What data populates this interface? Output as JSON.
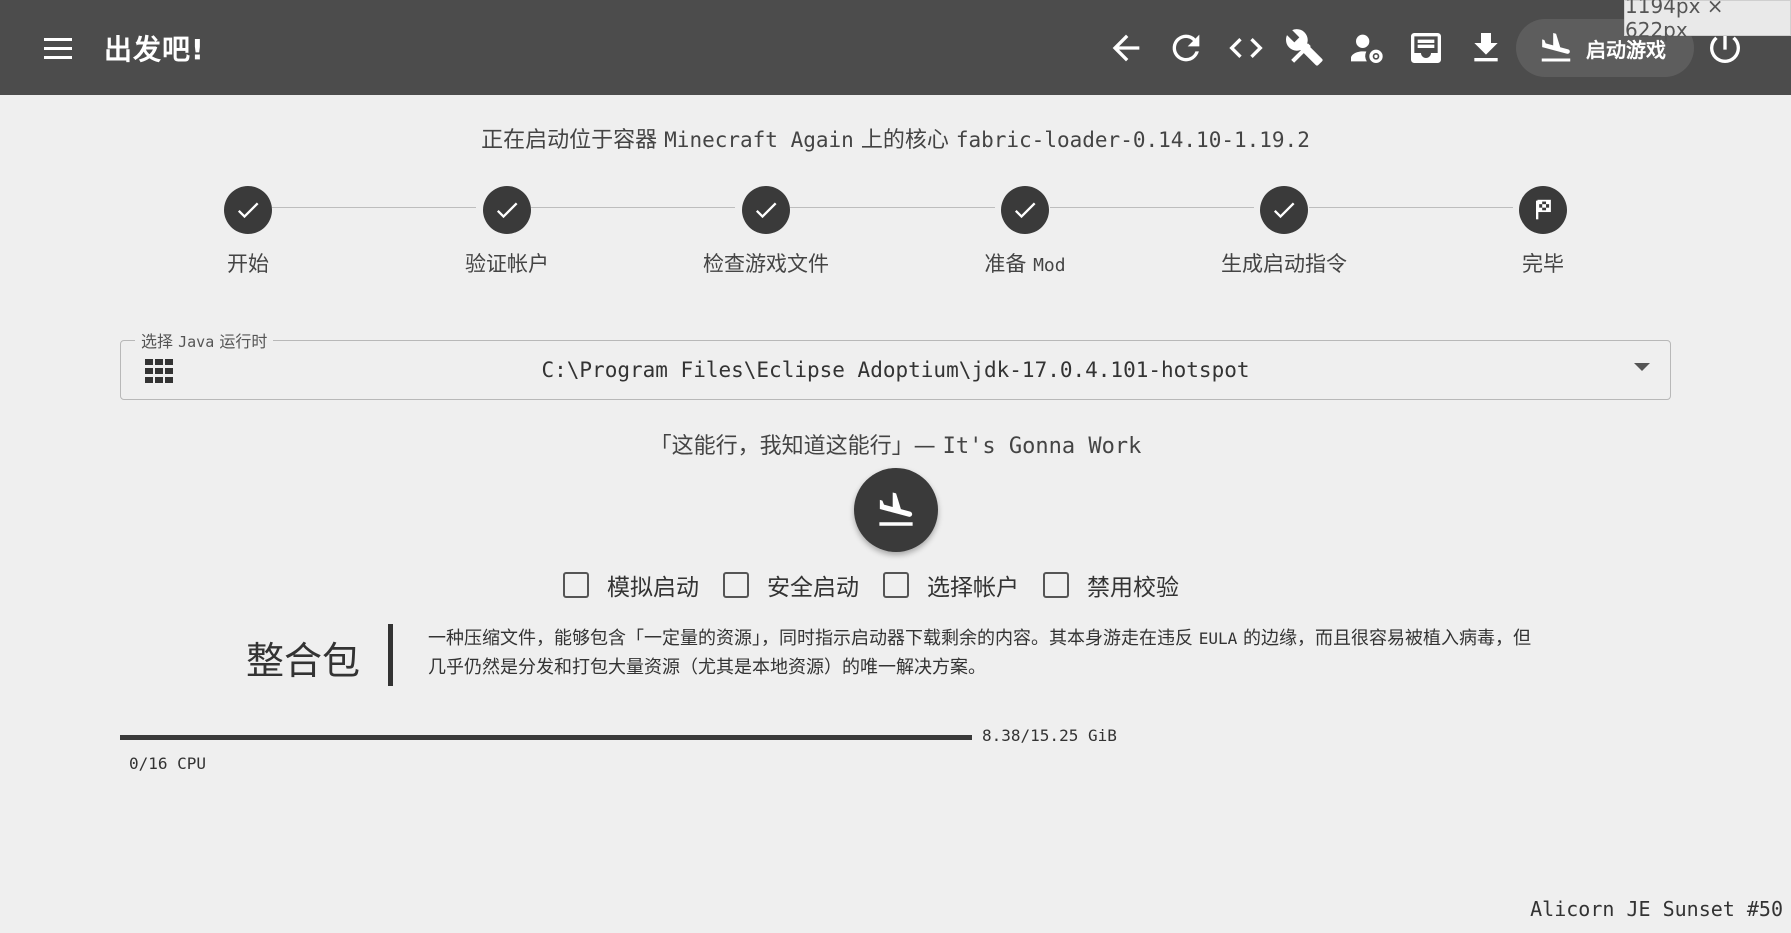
{
  "appbar": {
    "title": "出发吧!",
    "launch_label": "启动游戏",
    "size_badge": "1194px × 622px",
    "tools": [
      "back-icon",
      "reload-icon",
      "code-icon",
      "tools-icon",
      "account-settings-icon",
      "inbox-icon",
      "download-icon"
    ]
  },
  "launch": {
    "prefix": "正在启动位于容器",
    "container": "Minecraft Again",
    "middle": "上的核心",
    "core": "fabric-loader-0.14.10-1.19.2"
  },
  "steps": [
    {
      "label": "开始",
      "status": "done"
    },
    {
      "label": "验证帐户",
      "status": "done"
    },
    {
      "label": "检查游戏文件",
      "status": "done"
    },
    {
      "label_cn": "准备",
      "label_mono": "Mod",
      "status": "done"
    },
    {
      "label": "生成启动指令",
      "status": "done"
    },
    {
      "label": "完毕",
      "status": "finish"
    }
  ],
  "java": {
    "legend_cn1": "选择",
    "legend_mono": "Java",
    "legend_cn2": "运行时",
    "value": "C:\\Program Files\\Eclipse Adoptium\\jdk-17.0.4.101-hotspot"
  },
  "quote": {
    "cn": "「这能行，我知道这能行」—",
    "en": "It's Gonna Work"
  },
  "options": [
    "模拟启动",
    "安全启动",
    "选择帐户",
    "禁用校验"
  ],
  "tip": {
    "title": "整合包",
    "text_a": "一种压缩文件，能够包含「一定量的资源」，同时指示启动器下载剩余的内容。其本身游走在违反",
    "text_eula": "EULA",
    "text_b": "的边缘，而且很容易被植入病毒，但几乎仍然是分发和打包大量资源（尤其是本地资源）的唯一解决方案。"
  },
  "status": {
    "memory": "8.38/15.25 GiB",
    "memory_used_fraction": 0.55,
    "cpu": "0/16 CPU"
  },
  "version": "Alicorn JE Sunset #50",
  "colors": {
    "appbar": "#4c4c4c",
    "background": "#efefef",
    "accent": "#3a3a3a"
  }
}
